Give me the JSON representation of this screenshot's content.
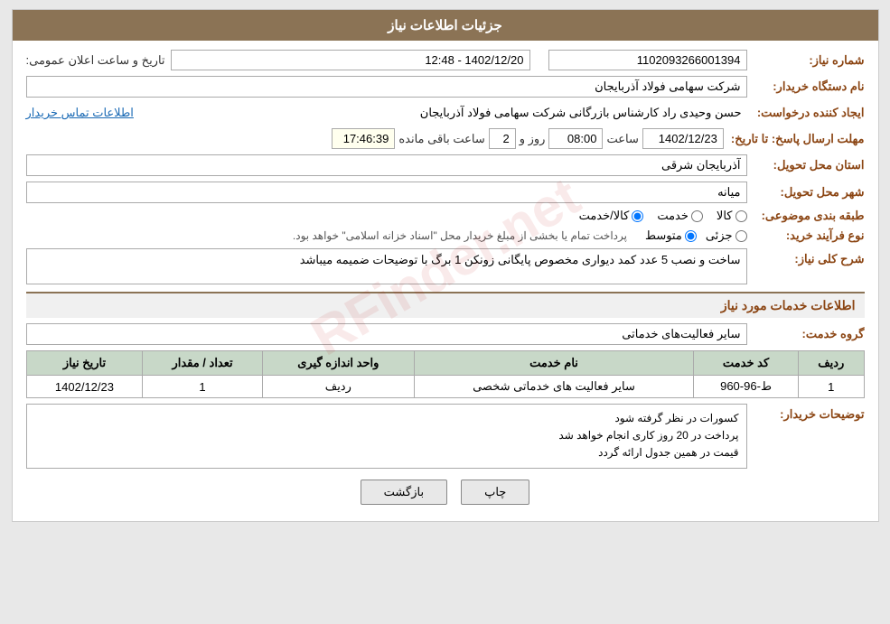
{
  "header": {
    "title": "جزئیات اطلاعات نیاز"
  },
  "fields": {
    "need_number_label": "شماره نیاز:",
    "need_number_value": "1102093266001394",
    "announce_date_label": "تاریخ و ساعت اعلان عمومی:",
    "announce_date_value": "1402/12/20 - 12:48",
    "buyer_name_label": "نام دستگاه خریدار:",
    "buyer_name_value": "شرکت سهامی فولاد آذربایجان",
    "creator_label": "ایجاد کننده درخواست:",
    "creator_value": "حسن وحیدی راد کارشناس بازرگانی شرکت سهامی فولاد آذربایجان",
    "contact_link": "اطلاعات تماس خریدار",
    "deadline_label": "مهلت ارسال پاسخ: تا تاریخ:",
    "deadline_date": "1402/12/23",
    "deadline_time_label": "ساعت",
    "deadline_time_value": "08:00",
    "deadline_days_label": "روز و",
    "deadline_days_value": "2",
    "deadline_remaining_label": "ساعت باقی مانده",
    "deadline_remaining_value": "17:46:39",
    "province_label": "استان محل تحویل:",
    "province_value": "آذربایجان شرقی",
    "city_label": "شهر محل تحویل:",
    "city_value": "میانه",
    "category_label": "طبقه بندی موضوعی:",
    "category_radio1": "کالا",
    "category_radio2": "خدمت",
    "category_radio3": "کالا/خدمت",
    "category_selected": "کالا",
    "purchase_type_label": "نوع فرآیند خرید:",
    "purchase_radio1": "جزئی",
    "purchase_radio2": "متوسط",
    "purchase_note": "پرداخت تمام یا بخشی از مبلغ خریدار محل \"اسناد خزانه اسلامی\" خواهد بود.",
    "need_desc_label": "شرح کلی نیاز:",
    "need_desc_value": "ساخت و نصب 5 عدد کمد دیواری مخصوص پایگانی زونکن 1 برگ با توضیحات ضمیمه میباشد",
    "services_section_label": "اطلاعات خدمات مورد نیاز",
    "service_group_label": "گروه خدمت:",
    "service_group_value": "سایر فعالیت‌های خدماتی",
    "table": {
      "headers": [
        "ردیف",
        "کد خدمت",
        "نام خدمت",
        "واحد اندازه گیری",
        "تعداد / مقدار",
        "تاریخ نیاز"
      ],
      "rows": [
        {
          "row": "1",
          "code": "ط-96-960",
          "name": "سایر فعالیت های خدماتی شخصی",
          "unit": "ردیف",
          "quantity": "1",
          "date": "1402/12/23"
        }
      ]
    },
    "buyer_notes_label": "توضیحات خریدار:",
    "buyer_notes_value": "کسورات در نظر گرفته شود\nپرداخت در 20 روز کاری انجام خواهد شد\nقیمت در همین جدول ارائه گردد"
  },
  "buttons": {
    "print_label": "چاپ",
    "back_label": "بازگشت"
  }
}
